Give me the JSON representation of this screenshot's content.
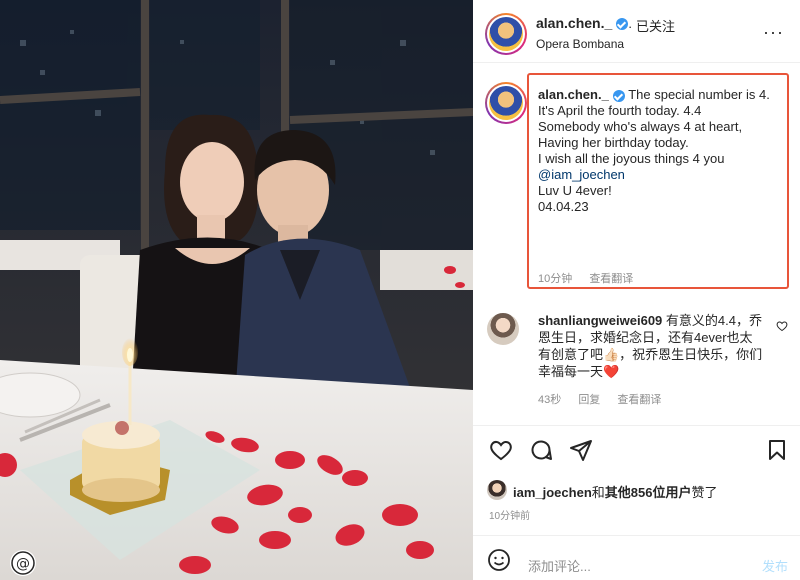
{
  "header": {
    "username": "alan.chen._",
    "follow_status": "· 已关注",
    "location": "Opera Bombana",
    "more_icon": "more-horizontal-icon"
  },
  "caption": {
    "username": "alan.chen._",
    "lines": [
      "The special number is 4.",
      "It's April the fourth today. 4.4",
      "Somebody who's always 4 at heart,",
      "Having her birthday today.",
      "I wish all the joyous things 4 you"
    ],
    "mention": "@iam_joechen",
    "line_after": "Luv U 4ever!",
    "date": "04.04.23",
    "time": "10分钟",
    "translate": "查看翻译",
    "highlight_color": "#e8553a"
  },
  "comment": {
    "username": "shanliangweiwei609",
    "text": "有意义的4.4，乔恩生日，求婚纪念日，还有4ever也太有创意了吧👍🏻，祝乔恩生日快乐，你们幸福每一天❤️",
    "time": "43秒",
    "reply": "回复",
    "translate": "查看翻译"
  },
  "actions": {
    "like_icon": "heart-icon",
    "comment_icon": "comment-icon",
    "share_icon": "share-icon",
    "save_icon": "bookmark-icon"
  },
  "likes": {
    "user": "iam_joechen",
    "middle": "和",
    "others": "其他856位用户",
    "suffix": "赞了"
  },
  "post_time": "10分钟前",
  "comment_box": {
    "placeholder": "添加评论...",
    "post_label": "发布"
  },
  "colors": {
    "verified": "#3897f0",
    "post_button": "#b2dffc",
    "mention": "#00376b"
  }
}
